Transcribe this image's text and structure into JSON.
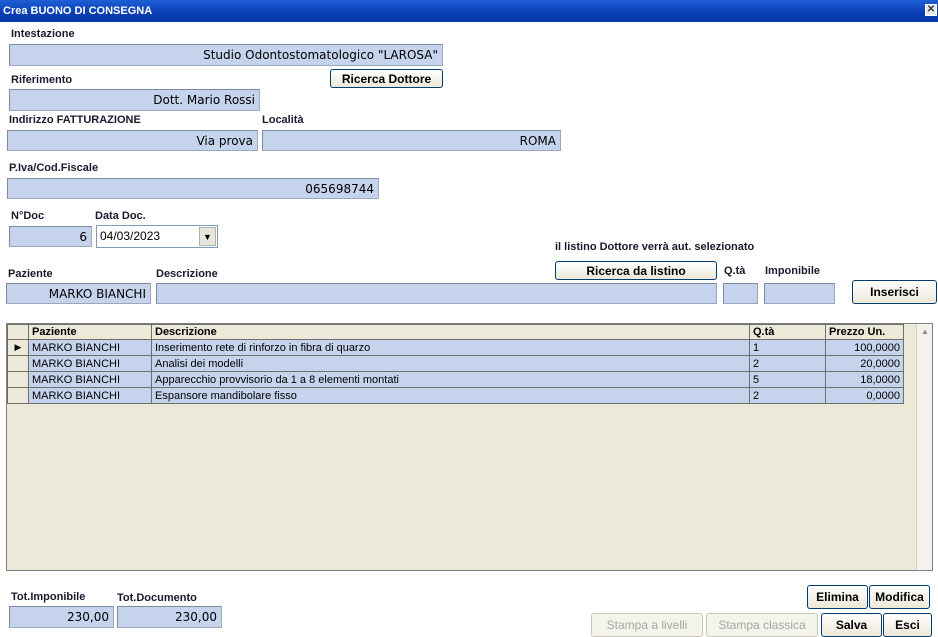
{
  "window": {
    "title": "Crea BUONO DI CONSEGNA",
    "close": "✕"
  },
  "intestazione": {
    "label": "Intestazione",
    "value": "Studio Odontostomatologico \"LAROSA\""
  },
  "riferimento": {
    "label": "Riferimento",
    "value": "Dott. Mario Rossi",
    "search_button": "Ricerca Dottore"
  },
  "indirizzo": {
    "label": "Indirizzo FATTURAZIONE",
    "value": "Via prova"
  },
  "localita": {
    "label": "Località",
    "value": "ROMA"
  },
  "piva": {
    "label": "P.Iva/Cod.Fiscale",
    "value": "065698744"
  },
  "ndoc": {
    "label": "N°Doc",
    "value": "6"
  },
  "datadoc": {
    "label": "Data Doc.",
    "value": "04/03/2023"
  },
  "listino_note": "il listino Dottore verrà aut. selezionato",
  "entry": {
    "paziente_label": "Paziente",
    "paziente_value": "MARKO BIANCHI",
    "descrizione_label": "Descrizione",
    "descrizione_value": "",
    "qta_label": "Q.tà",
    "qta_value": "",
    "imponibile_label": "Imponibile",
    "imponibile_value": "",
    "ricerca_listino_button": "Ricerca da listino",
    "inserisci_button": "Inserisci"
  },
  "grid": {
    "columns": [
      "Paziente",
      "Descrizione",
      "Q.tà",
      "Prezzo Un."
    ],
    "rows": [
      {
        "paziente": "MARKO BIANCHI",
        "descrizione": " Inserimento rete di rinforzo in fibra di quarzo",
        "qta": "1",
        "prezzo": "100,0000"
      },
      {
        "paziente": "MARKO BIANCHI",
        "descrizione": "Analisi dei modelli",
        "qta": "2",
        "prezzo": "20,0000"
      },
      {
        "paziente": "MARKO BIANCHI",
        "descrizione": "Apparecchio provvisorio da 1 a 8 elementi montati",
        "qta": "5",
        "prezzo": "18,0000"
      },
      {
        "paziente": "MARKO BIANCHI",
        "descrizione": "Espansore mandibolare fisso",
        "qta": "2",
        "prezzo": "0,0000"
      }
    ]
  },
  "totals": {
    "imponibile_label": "Tot.Imponibile",
    "imponibile_value": "230,00",
    "documento_label": "Tot.Documento",
    "documento_value": "230,00"
  },
  "actions": {
    "elimina": "Elimina",
    "modifica": "Modifica",
    "stampa_livelli": "Stampa a livelli",
    "stampa_classica": "Stampa classica",
    "salva": "Salva",
    "esci": "Esci"
  }
}
